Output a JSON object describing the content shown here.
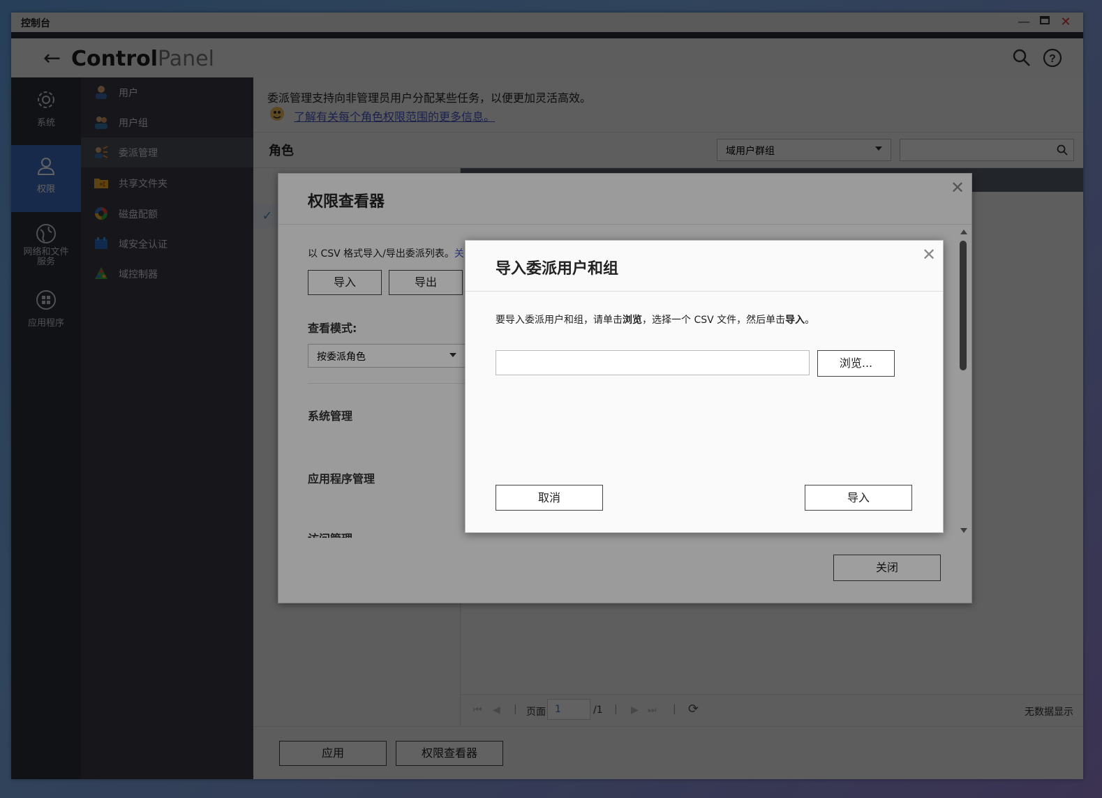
{
  "window": {
    "title": "控制台"
  },
  "header": {
    "brand_bold": "Control",
    "brand_light": "Panel"
  },
  "leftnav": [
    {
      "label": "系统"
    },
    {
      "label": "权限"
    },
    {
      "label": "网络和文件\n服务"
    },
    {
      "label": "应用程序"
    }
  ],
  "subnav": [
    {
      "label": "用户"
    },
    {
      "label": "用户组"
    },
    {
      "label": "委派管理"
    },
    {
      "label": "共享文件夹"
    },
    {
      "label": "磁盘配额"
    },
    {
      "label": "域安全认证"
    },
    {
      "label": "域控制器"
    }
  ],
  "main": {
    "intro": "委派管理支持向非管理员用户分配某些任务，以便更加灵活高效。",
    "help_link": "了解有关每个角色权限范围的更多信息。",
    "role_title": "角色",
    "group_select": "域用户群组",
    "pager": {
      "page_label": "页面",
      "page_value": "1",
      "total": "/1",
      "no_data": "无数据显示"
    },
    "apply_button": "应用",
    "viewer_button": "权限查看器"
  },
  "viewer_dialog": {
    "title": "权限查看器",
    "csv_text": "以 CSV 格式导入/导出委派列表。",
    "csv_link_fragment": "关",
    "import_button": "导入",
    "export_button": "导出",
    "view_mode_label": "查看模式:",
    "view_mode_value": "按委派角色",
    "sections": [
      "系统管理",
      "应用程序管理",
      "访问管理"
    ],
    "close_button": "关闭"
  },
  "import_dialog": {
    "title": "导入委派用户和组",
    "desc_1": "要导入委派用户和组，请单击",
    "desc_b1": "浏览",
    "desc_2": "，选择一个 CSV 文件，然后单击",
    "desc_b2": "导入",
    "desc_3": "。",
    "file_value": "",
    "browse_button": "浏览...",
    "cancel_button": "取消",
    "import_button": "导入"
  }
}
